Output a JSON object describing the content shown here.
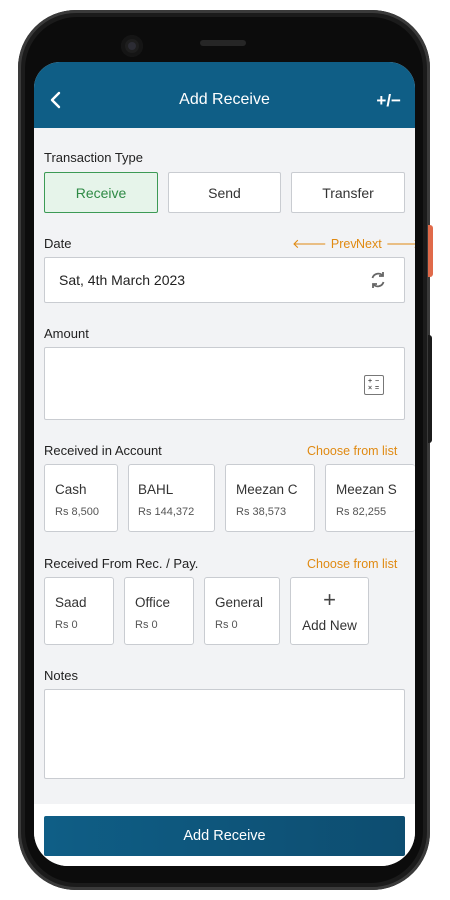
{
  "header": {
    "title": "Add Receive",
    "back_icon": "back-arrow-icon",
    "action_icon": "plus-minus-icon",
    "action_symbol": "+/−"
  },
  "transaction_type": {
    "label": "Transaction Type",
    "options": [
      "Receive",
      "Send",
      "Transfer"
    ],
    "selected": "Receive"
  },
  "date": {
    "label": "Date",
    "prev": "Prev",
    "next": "Next",
    "value": "Sat, 4th March 2023"
  },
  "amount": {
    "label": "Amount",
    "value": ""
  },
  "received_in_account": {
    "label": "Received in Account",
    "choose": "Choose from list",
    "accounts": [
      {
        "name": "Cash",
        "balance": "Rs 8,500"
      },
      {
        "name": "BAHL",
        "balance": "Rs 144,372"
      },
      {
        "name": "Meezan C",
        "balance": "Rs 38,573"
      },
      {
        "name": "Meezan S",
        "balance": "Rs 82,255"
      }
    ]
  },
  "received_from": {
    "label": "Received From Rec. / Pay.",
    "choose": "Choose from list",
    "parties": [
      {
        "name": "Saad",
        "balance": "Rs 0"
      },
      {
        "name": "Office",
        "balance": "Rs 0"
      },
      {
        "name": "General",
        "balance": "Rs 0"
      }
    ],
    "add_new": "Add New"
  },
  "notes": {
    "label": "Notes",
    "value": ""
  },
  "submit": {
    "label": "Add Receive"
  },
  "colors": {
    "primary": "#0f5e86",
    "accent": "#e08a12",
    "selected_bg": "#e6f4ea",
    "selected_text": "#2e8a45"
  }
}
